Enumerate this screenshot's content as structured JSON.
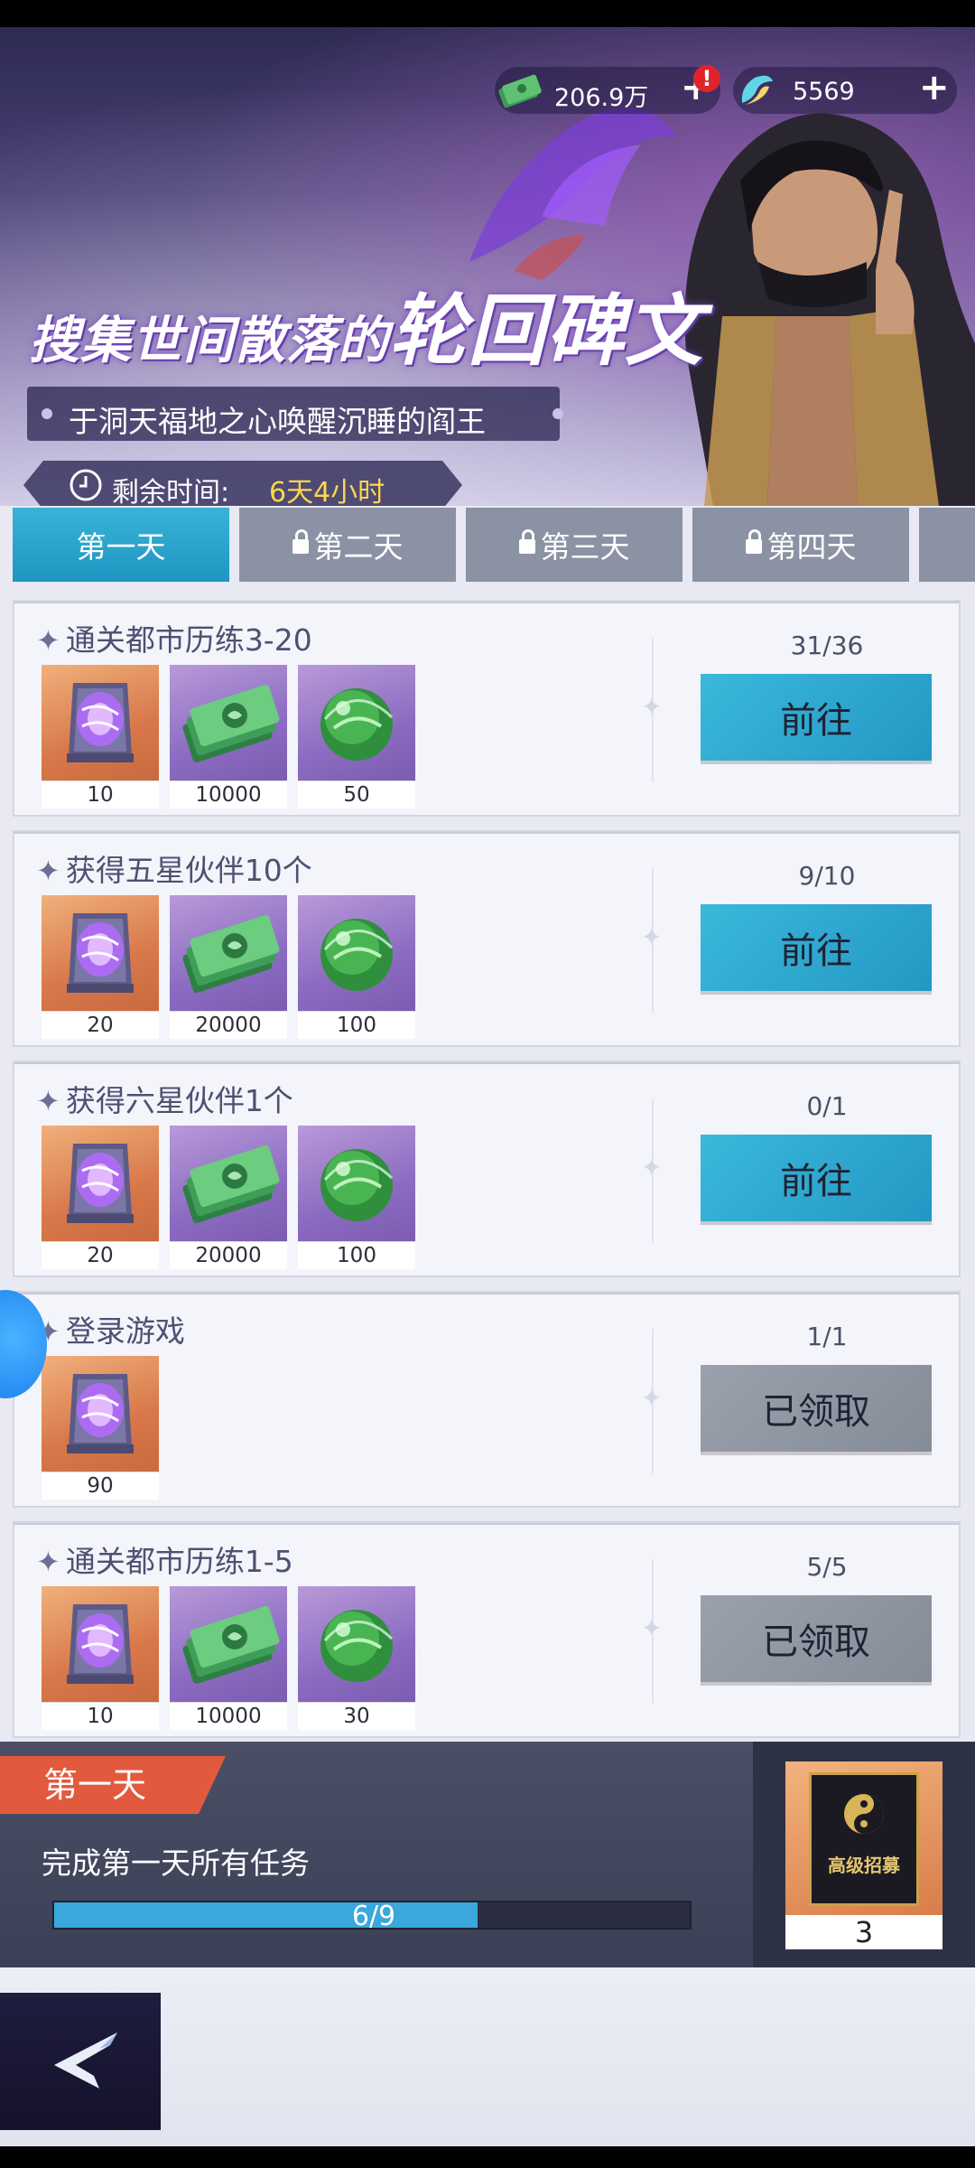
{
  "currency": {
    "money_value": "206.9万",
    "money_alert": "!",
    "gem_value": "5569",
    "plus": "+"
  },
  "banner": {
    "title_prefix": "搜集世间散落的",
    "title_highlight": "轮回碑文",
    "subtitle": "于洞天福地之心唤醒沉睡的阎王",
    "timer_label": "剩余时间:",
    "timer_value": "6天4小时"
  },
  "tabs": [
    {
      "label": "第一天",
      "locked": false,
      "active": true
    },
    {
      "label": "第二天",
      "locked": true,
      "active": false
    },
    {
      "label": "第三天",
      "locked": true,
      "active": false
    },
    {
      "label": "第四天",
      "locked": true,
      "active": false
    }
  ],
  "tasks": [
    {
      "title": "通关都市历练3-20",
      "progress": "31/36",
      "button": "前往",
      "button_state": "go",
      "rewards": [
        {
          "icon": "rune-tablet-icon",
          "count": "10"
        },
        {
          "icon": "cash-stack-icon",
          "count": "10000"
        },
        {
          "icon": "green-orb-icon",
          "count": "50"
        }
      ]
    },
    {
      "title": "获得五星伙伴10个",
      "progress": "9/10",
      "button": "前往",
      "button_state": "go",
      "rewards": [
        {
          "icon": "rune-tablet-icon",
          "count": "20"
        },
        {
          "icon": "cash-stack-icon",
          "count": "20000"
        },
        {
          "icon": "green-orb-icon",
          "count": "100"
        }
      ]
    },
    {
      "title": "获得六星伙伴1个",
      "progress": "0/1",
      "button": "前往",
      "button_state": "go",
      "rewards": [
        {
          "icon": "rune-tablet-icon",
          "count": "20"
        },
        {
          "icon": "cash-stack-icon",
          "count": "20000"
        },
        {
          "icon": "green-orb-icon",
          "count": "100"
        }
      ]
    },
    {
      "title": "登录游戏",
      "progress": "1/1",
      "button": "已领取",
      "button_state": "claimed",
      "rewards": [
        {
          "icon": "rune-tablet-icon",
          "count": "90"
        }
      ]
    },
    {
      "title": "通关都市历练1-5",
      "progress": "5/5",
      "button": "已领取",
      "button_state": "claimed",
      "rewards": [
        {
          "icon": "rune-tablet-icon",
          "count": "10"
        },
        {
          "icon": "cash-stack-icon",
          "count": "10000"
        },
        {
          "icon": "green-orb-icon",
          "count": "30"
        }
      ]
    }
  ],
  "summary": {
    "day_tag": "第一天",
    "description": "完成第一天所有任务",
    "progress_text": "6/9",
    "progress_fraction": 0.6667,
    "reward_card_text": "高级招募",
    "reward_count": "3"
  },
  "colors": {
    "accent_blue": "#2ba3d0",
    "claimed_gray": "#8d949f",
    "tag_red": "#e25a3e",
    "timer_yellow": "#ffd84a"
  }
}
